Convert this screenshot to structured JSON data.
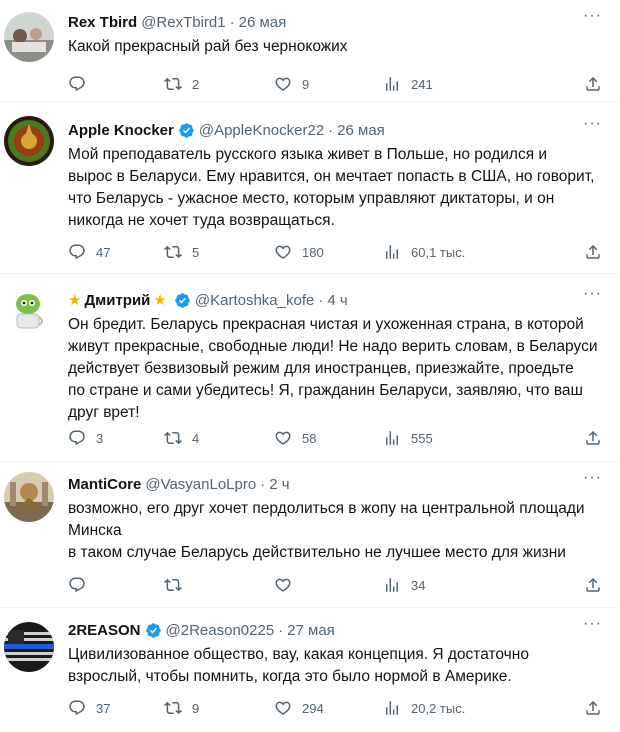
{
  "tweets": [
    {
      "name": "Rex Tbird",
      "star": false,
      "verified": false,
      "handle": "@RexTbird1",
      "time": "26 мая",
      "text": "Какой прекрасный рай без чернокожих",
      "stats": {
        "replies": "",
        "retweets": "2",
        "likes": "9",
        "views": "241"
      }
    },
    {
      "name": "Apple Knocker",
      "star": false,
      "verified": true,
      "handle": "@AppleKnocker22",
      "time": "26 мая",
      "text": "Мой преподаватель русского языка живет в Польше, но родился и\nвырос в Беларуси. Ему нравится, он мечтает попасть в США, но говорит,\nчто Беларусь - ужасное место, которым управляют диктаторы, и он\nникогда не хочет туда возвращаться.",
      "stats": {
        "replies": "47",
        "retweets": "5",
        "likes": "180",
        "views": "60,1 тыс."
      }
    },
    {
      "name": "Дмитрий",
      "star": true,
      "verified": true,
      "handle": "@Kartoshka_kofe",
      "time": "4 ч",
      "text": "Он бредит. Беларусь прекрасная чистая и ухоженная страна, в которой\nживут прекрасные, свободные люди! Не надо верить словам, в Беларуси\nдействует безвизовый режим для иностранцев, приезжайте, проедьте\nпо стране и сами убедитесь! Я, гражданин Беларуси, заявляю, что ваш\nдруг врет!",
      "stats": {
        "replies": "3",
        "retweets": "4",
        "likes": "58",
        "views": "555"
      }
    },
    {
      "name": "MantiCore",
      "star": false,
      "verified": false,
      "handle": "@VasyanLoLpro",
      "time": "2 ч",
      "text": "возможно, его друг хочет пердолиться в жопу на центральной площади\nМинска\nв таком случае Беларусь действительно не лучшее место для жизни",
      "stats": {
        "replies": "",
        "retweets": "",
        "likes": "",
        "views": "34"
      }
    },
    {
      "name": "2REASON",
      "star": false,
      "verified": true,
      "handle": "@2Reason0225",
      "time": "27 мая",
      "text": "Цивилизованное общество, вау, какая концепция. Я достаточно\nвзрослый, чтобы помнить, когда это было нормой в Америке.",
      "stats": {
        "replies": "37",
        "retweets": "9",
        "likes": "294",
        "views": "20,2 тыс."
      }
    }
  ],
  "separator": "·",
  "star_glyph": "★",
  "more_glyph": "···",
  "icons": [
    "reply-icon",
    "retweet-icon",
    "like-icon",
    "views-icon",
    "share-icon",
    "verified-badge-icon",
    "star-emoji-icon",
    "more-icon"
  ],
  "colors": {
    "text": "#0f1419",
    "secondary": "#536471",
    "verified": "#1d9bf0",
    "star": "#f4b400",
    "divider": "#eff3f4"
  }
}
